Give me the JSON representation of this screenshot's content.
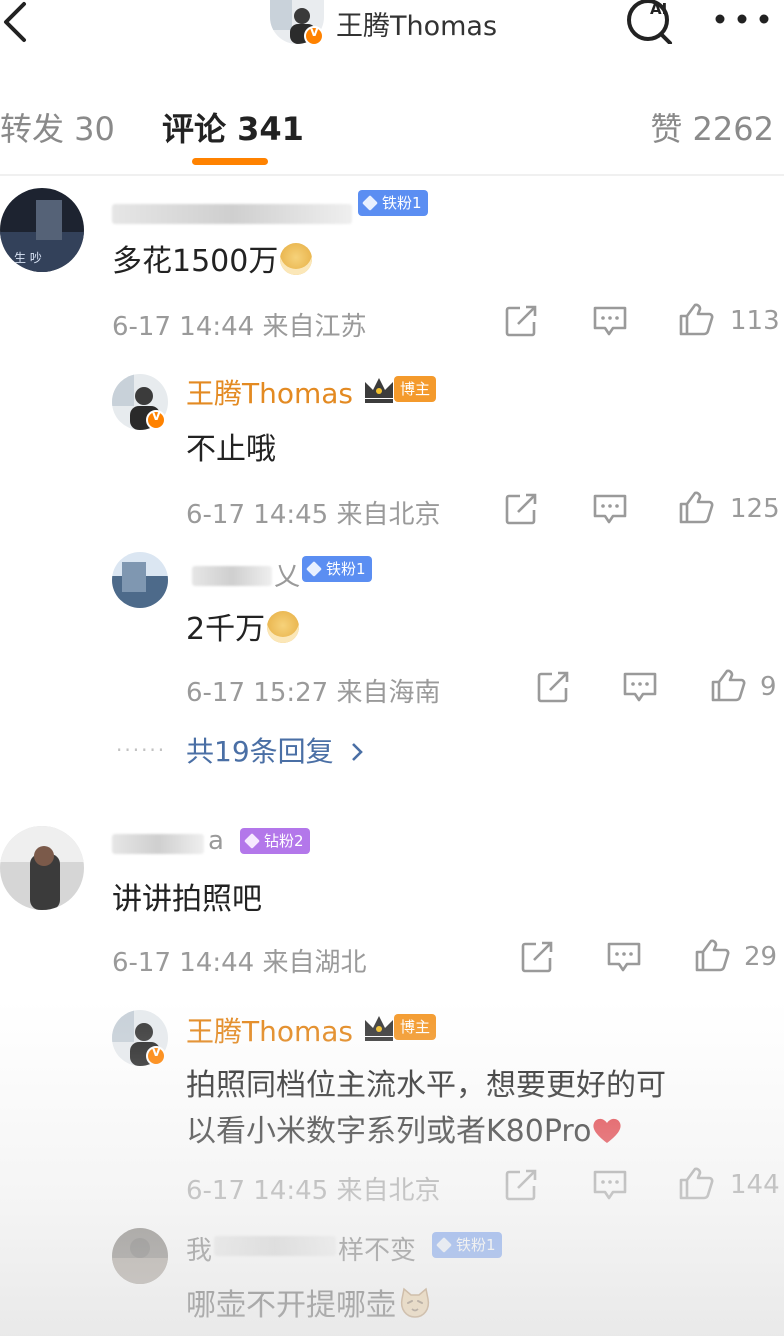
{
  "header": {
    "title": "王腾Thomas",
    "icons": [
      "back-icon",
      "ai-search-icon",
      "more-icon"
    ],
    "ai_label": "AI"
  },
  "tabs": {
    "repost": "转发 30",
    "comments": "评论 341",
    "likes": "赞 2262"
  },
  "comments": [
    {
      "badge": "铁粉1",
      "text": "多花1500万",
      "emoji": "doge-emoji",
      "time": "6-17 14:44",
      "location": "来自江苏",
      "likes": "113",
      "replies": [
        {
          "author": "王腾Thomas",
          "role_badge": "博主",
          "text": "不止哦",
          "time": "6-17 14:45",
          "location": "来自北京",
          "likes": "125"
        },
        {
          "name_fragment": "乂",
          "badge": "铁粉1",
          "text": "2千万",
          "emoji": "doge-emoji",
          "time": "6-17 15:27",
          "location": "来自海南",
          "likes": "9"
        }
      ],
      "more_replies": "共19条回复"
    },
    {
      "name_fragment": "a",
      "badge": "钻粉2",
      "text": "讲讲拍照吧",
      "time": "6-17 14:44",
      "location": "来自湖北",
      "likes": "29",
      "replies": [
        {
          "author": "王腾Thomas",
          "role_badge": "博主",
          "text_line1": "拍照同档位主流水平，想要更好的可",
          "text_line2": "以看小米数字系列或者K80Pro",
          "emoji": "heart-emoji",
          "time": "6-17 14:45",
          "location": "来自北京",
          "likes": "144"
        },
        {
          "name_fragment_a": "我",
          "name_fragment_b": "样不变",
          "badge": "铁粉1",
          "text": "哪壶不开提哪壶",
          "emoji": "cat-emoji"
        }
      ]
    }
  ],
  "colors": {
    "accent": "#ff8200",
    "author": "#e38a22",
    "link": "#4a6fa5",
    "iron_badge": "#5b8ef2",
    "diamond_badge": "#b377ea",
    "host_badge": "#f49a2c"
  }
}
